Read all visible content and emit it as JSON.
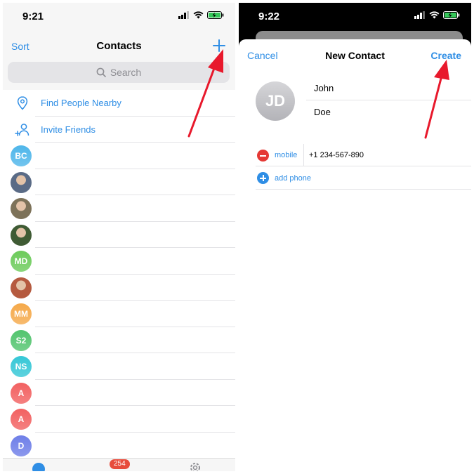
{
  "colors": {
    "accent": "#2f8ee5",
    "arrow": "#e8192c",
    "destructive": "#e53935"
  },
  "left": {
    "status": {
      "time": "9:21"
    },
    "nav": {
      "sort": "Sort",
      "title": "Contacts",
      "add_icon": "plus-icon"
    },
    "search": {
      "placeholder": "Search",
      "icon": "search-icon"
    },
    "actions": [
      {
        "label": "Find People Nearby",
        "icon": "location-pin-icon"
      },
      {
        "label": "Invite Friends",
        "icon": "add-person-icon"
      }
    ],
    "contacts": [
      {
        "initials": "BC",
        "color": "#4fb6ea"
      },
      {
        "initials": "",
        "color": "#5a6b86"
      },
      {
        "initials": "",
        "color": "#7d7259"
      },
      {
        "initials": "",
        "color": "#3f5b34"
      },
      {
        "initials": "MD",
        "color": "#6ccb5a"
      },
      {
        "initials": "",
        "color": "#b55a3f"
      },
      {
        "initials": "MM",
        "color": "#f5a94a"
      },
      {
        "initials": "S2",
        "color": "#52c46e"
      },
      {
        "initials": "NS",
        "color": "#35c7d6"
      },
      {
        "initials": "A",
        "color": "#f26161"
      },
      {
        "initials": "A",
        "color": "#f26161"
      },
      {
        "initials": "D",
        "color": "#6f7fe8"
      }
    ],
    "tabbar": {
      "badge": "254"
    }
  },
  "right": {
    "status": {
      "time": "9:22"
    },
    "nav": {
      "cancel": "Cancel",
      "title": "New Contact",
      "create": "Create"
    },
    "avatar": {
      "initials": "JD"
    },
    "first_name": "John",
    "last_name": "Doe",
    "phone": {
      "type": "mobile",
      "number": "+1 234-567-890"
    },
    "add_phone": "add phone"
  }
}
